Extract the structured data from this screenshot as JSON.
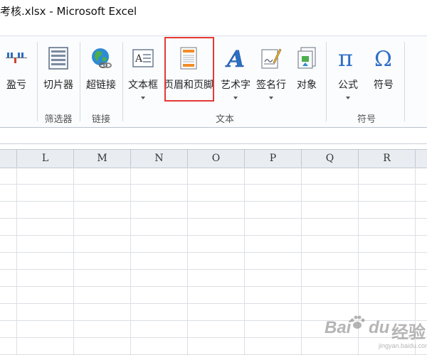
{
  "title": "考核.xlsx - Microsoft Excel",
  "ribbon": {
    "buttons": [
      {
        "name": "win-loss-button",
        "label": "盈亏",
        "icon": "winloss-sparkline-icon",
        "caret": false
      },
      {
        "name": "slicer-button",
        "label": "切片器",
        "icon": "slicer-icon",
        "caret": false
      },
      {
        "name": "hyperlink-button",
        "label": "超链接",
        "icon": "hyperlink-globe-icon",
        "caret": false
      },
      {
        "name": "text-box-button",
        "label": "文本框",
        "icon": "text-box-icon",
        "caret": true
      },
      {
        "name": "header-footer-button",
        "label": "页眉和页脚",
        "icon": "header-footer-icon",
        "caret": false
      },
      {
        "name": "wordart-button",
        "label": "艺术字",
        "icon": "wordart-icon",
        "caret": true
      },
      {
        "name": "signature-line-button",
        "label": "签名行",
        "icon": "signature-line-icon",
        "caret": true
      },
      {
        "name": "object-button",
        "label": "对象",
        "icon": "object-icon",
        "caret": false
      },
      {
        "name": "equation-button",
        "label": "公式",
        "icon": "pi-icon",
        "caret": true
      },
      {
        "name": "symbol-button",
        "label": "符号",
        "icon": "omega-icon",
        "caret": false
      }
    ],
    "groups": {
      "filter": "筛选器",
      "links": "链接",
      "text": "文本",
      "symbols": "符号"
    }
  },
  "grid": {
    "columns": [
      "L",
      "M",
      "N",
      "O",
      "P",
      "Q",
      "R"
    ]
  },
  "watermark": {
    "brand_a": "Bai",
    "brand_b": "du",
    "brand_c": "经验",
    "url": "jingyan.baidu.com"
  },
  "colors": {
    "highlight": "#e53935",
    "ribbon_bg": "#fbfcfe",
    "header_bg": "#e9edf2"
  }
}
